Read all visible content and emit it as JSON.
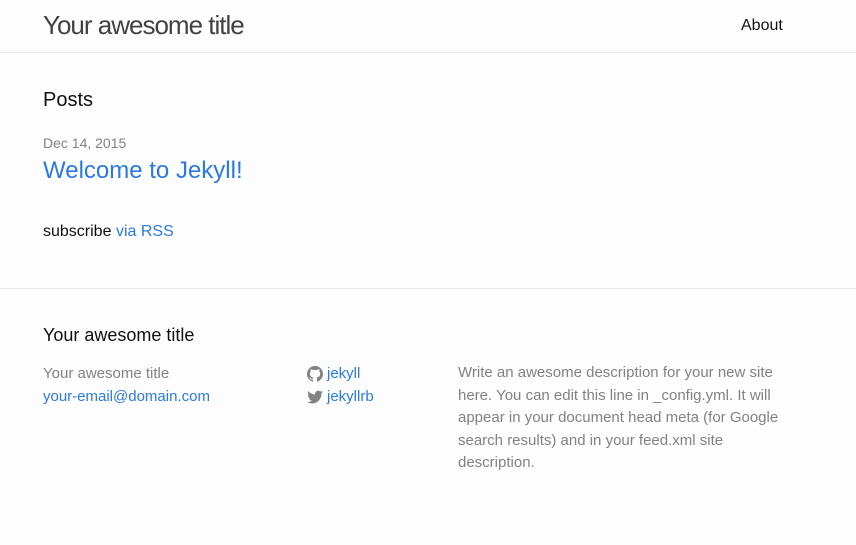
{
  "header": {
    "site_title": "Your awesome title",
    "nav": {
      "about": "About"
    }
  },
  "main": {
    "posts_heading": "Posts",
    "posts": [
      {
        "date": "Dec 14, 2015",
        "title": "Welcome to Jekyll!"
      }
    ],
    "rss": {
      "prefix": "subscribe",
      "link": "via RSS"
    }
  },
  "footer": {
    "heading": "Your awesome title",
    "col1": {
      "name": "Your awesome title",
      "email": "your-email@domain.com"
    },
    "col2": {
      "github": {
        "icon": "github-icon",
        "username": "jekyll"
      },
      "twitter": {
        "icon": "twitter-icon",
        "username": "jekyllrb"
      }
    },
    "description": "Write an awesome description for your new site here. You can edit this line in _config.yml. It will appear in your document head meta (for Google search results) and in your feed.xml site description."
  },
  "colors": {
    "link": "#2a7ae2",
    "text": "#111111",
    "muted": "#828282",
    "border": "#e8e8e8",
    "background": "#fdfdfd"
  }
}
